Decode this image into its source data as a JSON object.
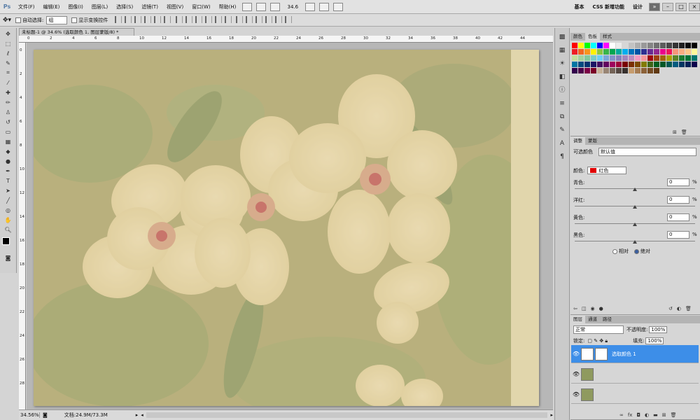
{
  "app": {
    "logo": "Ps"
  },
  "menu": [
    "文件(F)",
    "编辑(E)",
    "图像(I)",
    "图层(L)",
    "选择(S)",
    "滤镜(T)",
    "视图(V)",
    "窗口(W)",
    "帮助(H)"
  ],
  "zoom_field": "34.6",
  "workspaces": [
    "基本",
    "CSS 新增功能",
    "设计"
  ],
  "options": {
    "auto_select": "自动选择:",
    "auto_select_value": "组",
    "show_transform": "显示变换控件"
  },
  "document_tab": "未标题-1 @ 34.6% (选取颜色 1, 图层蒙版/8) *",
  "ruler_h": [
    "0",
    "2",
    "4",
    "6",
    "8",
    "10",
    "12",
    "14",
    "16",
    "18",
    "20",
    "22",
    "24",
    "26",
    "28",
    "30",
    "32",
    "34",
    "36",
    "38",
    "40",
    "42",
    "44"
  ],
  "ruler_v": [
    "0",
    "2",
    "4",
    "6",
    "8",
    "10",
    "12",
    "14",
    "16",
    "18",
    "20",
    "22",
    "24",
    "26",
    "28"
  ],
  "status": {
    "zoom": "34.56%",
    "doc_size": "文档:24.9M/73.3M"
  },
  "swatch_panel": {
    "tabs": [
      "颜色",
      "色板",
      "样式"
    ],
    "active": 1
  },
  "swatches": [
    "#ff0000",
    "#ffff00",
    "#00ff00",
    "#00ffff",
    "#0000ff",
    "#ff00ff",
    "#ffffff",
    "#ebebeb",
    "#d6d6d6",
    "#c2c2c2",
    "#adadad",
    "#999999",
    "#858585",
    "#707070",
    "#5c5c5c",
    "#474747",
    "#333333",
    "#1f1f1f",
    "#0a0a0a",
    "#000000",
    "#ee1d24",
    "#f26522",
    "#f7941d",
    "#fff200",
    "#8dc63f",
    "#39b54a",
    "#00a651",
    "#00a99d",
    "#00aeef",
    "#0072bc",
    "#0054a6",
    "#2e3192",
    "#662d91",
    "#92278f",
    "#ec008c",
    "#ed145b",
    "#f69679",
    "#f9ad81",
    "#fdc689",
    "#fff79a",
    "#c4df9b",
    "#a3d39c",
    "#82ca9c",
    "#7accc8",
    "#6dcff6",
    "#7da7d9",
    "#8393ca",
    "#8781bd",
    "#a187be",
    "#bd8cbf",
    "#f49ac1",
    "#f5989d",
    "#9e0b0f",
    "#a0410d",
    "#a36209",
    "#aba000",
    "#598527",
    "#1a7b30",
    "#007236",
    "#00746b",
    "#0076a3",
    "#004b80",
    "#003471",
    "#1b1464",
    "#440e62",
    "#630460",
    "#9e005d",
    "#9e0039",
    "#790000",
    "#7b2e00",
    "#7d4900",
    "#827b00",
    "#406618",
    "#005e20",
    "#005826",
    "#005952",
    "#005b7f",
    "#003663",
    "#002157",
    "#0d004c",
    "#32004b",
    "#4b0049",
    "#7b0046",
    "#7a0026",
    "#c7b299",
    "#998675",
    "#736357",
    "#534741",
    "#37302d",
    "#c69c6d",
    "#a67c52",
    "#8c6239",
    "#754c24",
    "#603913"
  ],
  "adjust_panel": {
    "tabs": [
      "调整",
      "蒙版"
    ],
    "title": "可选颜色",
    "preset": "默认值",
    "color_label": "颜色:",
    "color_value": "红色",
    "color_chip": "#e00000",
    "sliders": [
      {
        "label": "青色:",
        "value": "0",
        "unit": "%",
        "level": 0.5
      },
      {
        "label": "洋红:",
        "value": "0",
        "unit": "%",
        "level": 0.5
      },
      {
        "label": "黄色:",
        "value": "0",
        "unit": "%",
        "level": 0.5
      },
      {
        "label": "黑色:",
        "value": "0",
        "unit": "%",
        "level": 0.5
      }
    ],
    "radio_relative": "相对",
    "radio_absolute": "绝对"
  },
  "layers_panel": {
    "tabs": [
      "图层",
      "通道",
      "路径"
    ],
    "blend_mode": "正常",
    "opacity_label": "不透明度:",
    "opacity": "100%",
    "lock_label": "锁定:",
    "fill_label": "填充:",
    "fill": "100%",
    "layers": [
      {
        "name": "选取颜色 1",
        "selected": true
      },
      {
        "name": "",
        "selected": false
      },
      {
        "name": "",
        "selected": false
      }
    ]
  }
}
